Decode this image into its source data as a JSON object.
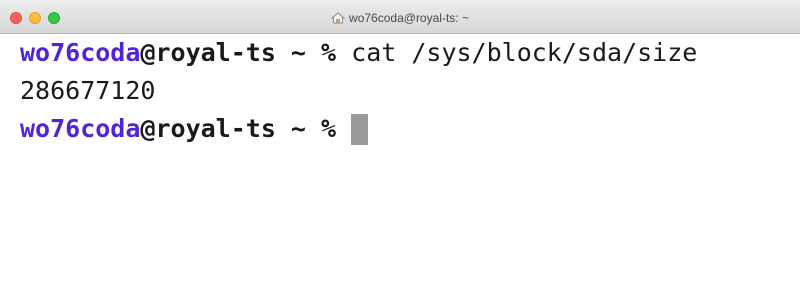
{
  "window": {
    "title": "wo76coda@royal-ts: ~",
    "title_icon": "home-icon",
    "buttons": [
      "close",
      "minimize",
      "zoom"
    ]
  },
  "terminal": {
    "lines": [
      {
        "user": "wo76coda",
        "host": "@royal-ts ~ %",
        "command": " cat /sys/block/sda/size"
      },
      {
        "output": "286677120"
      },
      {
        "user": "wo76coda",
        "host": "@royal-ts ~ %",
        "command": " "
      }
    ],
    "colors": {
      "username": "#5224d6",
      "text": "#1a1a1a",
      "cursor": "#9a9a9a"
    }
  }
}
